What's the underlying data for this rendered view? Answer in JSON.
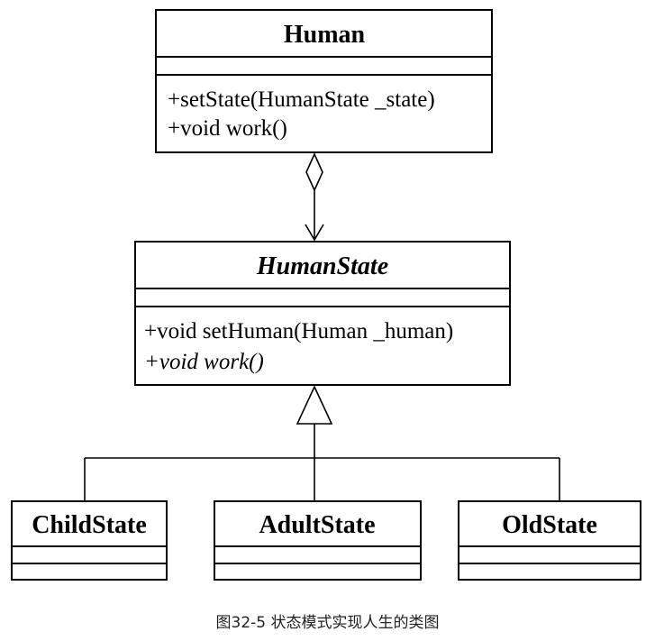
{
  "classes": {
    "human": {
      "name": "Human",
      "operations": [
        "+setState(HumanState _state)",
        "+void work()"
      ]
    },
    "human_state": {
      "name": "HumanState",
      "operations": [
        "+void setHuman(Human _human)",
        "+void work()"
      ]
    },
    "child_state": {
      "name": "ChildState"
    },
    "adult_state": {
      "name": "AdultState"
    },
    "old_state": {
      "name": "OldState"
    }
  },
  "caption": "图32-5 状态模式实现人生的类图"
}
